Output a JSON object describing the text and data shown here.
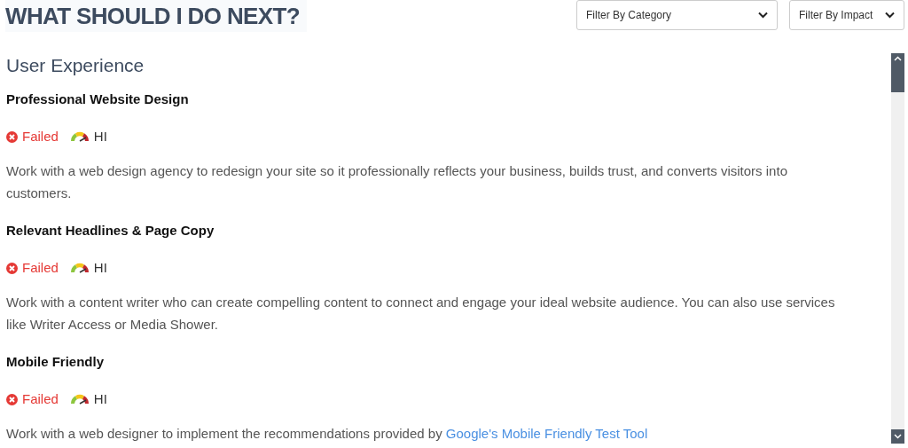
{
  "title": "WHAT SHOULD I DO NEXT?",
  "filters": [
    {
      "label": "Filter By Category"
    },
    {
      "label": "Filter By Impact"
    }
  ],
  "section": "User Experience",
  "items": [
    {
      "title": "Professional Website Design",
      "kind": "failed",
      "status_label": "Failed",
      "impact": "HI",
      "description": "Work with a web design agency to redesign your site so it professionally reflects your business, builds trust, and converts visitors into customers."
    },
    {
      "title": "Relevant Headlines & Page Copy",
      "kind": "failed",
      "status_label": "Failed",
      "impact": "HI",
      "description": "Work with a content writer who can create compelling content to connect and engage your ideal website audience. You can also use services like Writer Access or Media Shower."
    },
    {
      "title": "Mobile Friendly",
      "kind": "failed",
      "status_label": "Failed",
      "impact": "HI",
      "description": "Work with a web designer to implement the recommendations provided by",
      "link": "Google's Mobile Friendly Test Tool"
    }
  ]
}
